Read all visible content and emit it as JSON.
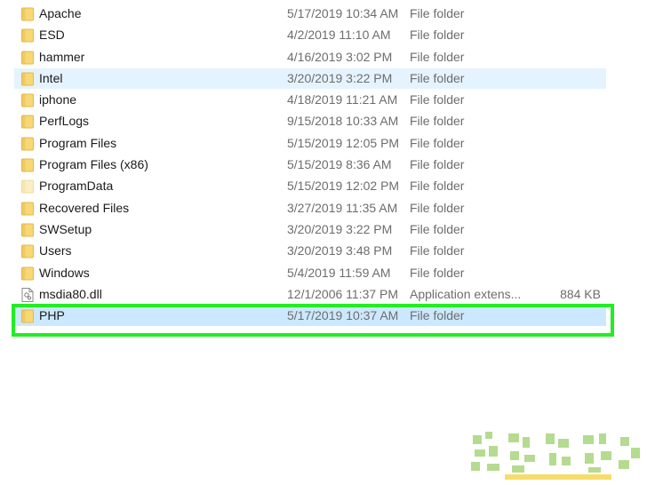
{
  "colors": {
    "folder": "#f8d775",
    "folder_dark": "#e6b94a",
    "highlight": "#22ee22",
    "selection": "#cce8ff",
    "hover": "#e5f3ff",
    "meta_text": "#6d6d6d"
  },
  "files": [
    {
      "name": "Apache",
      "date": "5/17/2019 10:34 AM",
      "type": "File folder",
      "size": "",
      "icon": "folder-icon",
      "state": ""
    },
    {
      "name": "ESD",
      "date": "4/2/2019 11:10 AM",
      "type": "File folder",
      "size": "",
      "icon": "folder-icon",
      "state": ""
    },
    {
      "name": "hammer",
      "date": "4/16/2019 3:02 PM",
      "type": "File folder",
      "size": "",
      "icon": "folder-icon",
      "state": ""
    },
    {
      "name": "Intel",
      "date": "3/20/2019 3:22 PM",
      "type": "File folder",
      "size": "",
      "icon": "folder-icon",
      "state": "hover"
    },
    {
      "name": "iphone",
      "date": "4/18/2019 11:21 AM",
      "type": "File folder",
      "size": "",
      "icon": "folder-icon",
      "state": ""
    },
    {
      "name": "PerfLogs",
      "date": "9/15/2018 10:33 AM",
      "type": "File folder",
      "size": "",
      "icon": "folder-icon",
      "state": ""
    },
    {
      "name": "Program Files",
      "date": "5/15/2019 12:05 PM",
      "type": "File folder",
      "size": "",
      "icon": "folder-icon",
      "state": ""
    },
    {
      "name": "Program Files (x86)",
      "date": "5/15/2019 8:36 AM",
      "type": "File folder",
      "size": "",
      "icon": "folder-icon",
      "state": ""
    },
    {
      "name": "ProgramData",
      "date": "5/15/2019 12:02 PM",
      "type": "File folder",
      "size": "",
      "icon": "hidden-folder-icon",
      "state": ""
    },
    {
      "name": "Recovered Files",
      "date": "3/27/2019 11:35 AM",
      "type": "File folder",
      "size": "",
      "icon": "folder-icon",
      "state": ""
    },
    {
      "name": "SWSetup",
      "date": "3/20/2019 3:22 PM",
      "type": "File folder",
      "size": "",
      "icon": "folder-icon",
      "state": ""
    },
    {
      "name": "Users",
      "date": "3/20/2019 3:48 PM",
      "type": "File folder",
      "size": "",
      "icon": "folder-icon",
      "state": ""
    },
    {
      "name": "Windows",
      "date": "5/4/2019 11:59 AM",
      "type": "File folder",
      "size": "",
      "icon": "folder-icon",
      "state": ""
    },
    {
      "name": "msdia80.dll",
      "date": "12/1/2006 11:37 PM",
      "type": "Application extens...",
      "size": "884 KB",
      "icon": "dll-file-icon",
      "state": ""
    },
    {
      "name": "PHP",
      "date": "5/17/2019 10:37 AM",
      "type": "File folder",
      "size": "",
      "icon": "folder-icon",
      "state": "selected"
    }
  ]
}
